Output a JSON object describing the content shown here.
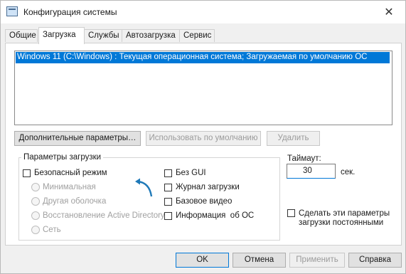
{
  "window": {
    "title": "Конфигурация системы",
    "close_glyph": "✕"
  },
  "tabs": [
    "Общие",
    "Загрузка",
    "Службы",
    "Автозагрузка",
    "Сервис"
  ],
  "os_list": {
    "entries": [
      "Windows 11 (C:\\Windows) : Текущая операционная система; Загружаемая по умолчанию ОС"
    ]
  },
  "buttons": {
    "advanced": "Дополнительные параметры…",
    "set_default": "Использовать по умолчанию",
    "delete": "Удалить"
  },
  "boot_options": {
    "title": "Параметры загрузки",
    "safe_mode": "Безопасный режим",
    "minimal": "Минимальная",
    "alternate_shell": "Другая оболочка",
    "ad_repair": "Восстановление Active Directory",
    "network": "Сеть",
    "no_gui": "Без GUI",
    "boot_log": "Журнал загрузки",
    "base_video": "Базовое видео",
    "os_info": "Информация  об ОС"
  },
  "timeout": {
    "label": "Таймаут:",
    "value": "30",
    "unit": "сек."
  },
  "permanent": {
    "line1": "Сделать эти параметры",
    "line2": "загрузки постоянными"
  },
  "footer": {
    "ok": "OK",
    "cancel": "Отмена",
    "apply": "Применить",
    "help": "Справка"
  },
  "colors": {
    "selection": "#0078d7",
    "arrow": "#1f79b8"
  }
}
